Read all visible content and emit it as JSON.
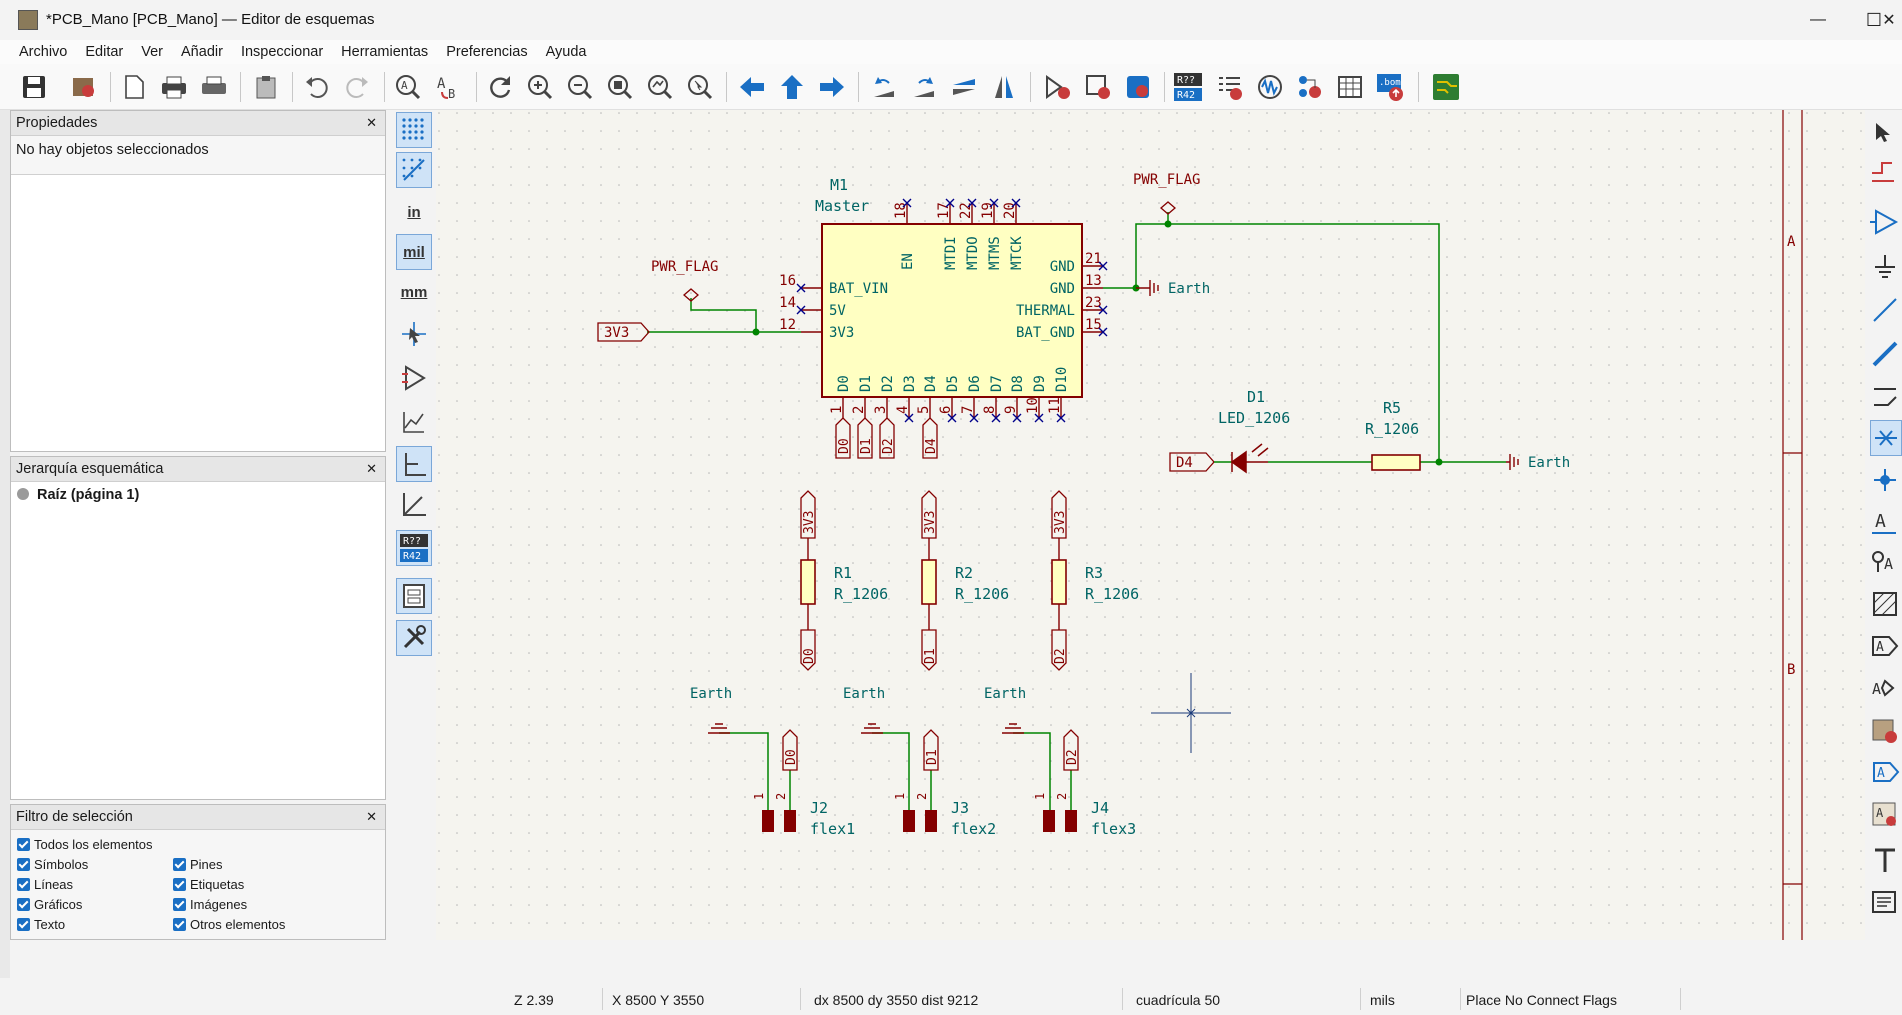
{
  "window": {
    "title": "*PCB_Mano [PCB_Mano] — Editor de esquemas",
    "controls": {
      "minimize": "—",
      "maximize": "☐",
      "close": "✕"
    }
  },
  "menu": [
    "Archivo",
    "Editar",
    "Ver",
    "Añadir",
    "Inspeccionar",
    "Herramientas",
    "Preferencias",
    "Ayuda"
  ],
  "toolbar": {
    "icons": [
      "save-icon",
      "schematic-setup-icon",
      "page-settings-icon",
      "print-icon",
      "plot-icon",
      "paste-icon",
      "undo-icon",
      "redo-icon",
      "find-icon",
      "find-replace-icon",
      "refresh-icon",
      "zoom-in-icon",
      "zoom-out-icon",
      "zoom-fit-icon",
      "zoom-objects-icon",
      "zoom-selection-icon",
      "navigate-back-icon",
      "navigate-up-icon",
      "navigate-forward-icon",
      "rotate-ccw-icon",
      "rotate-cw-icon",
      "mirror-vertical-icon",
      "mirror-horizontal-icon",
      "symbol-editor-icon",
      "symbol-browser-icon",
      "footprint-assign-icon",
      "annotate-icon",
      "erc-icon",
      "simulator-icon",
      "field-editor-icon",
      "bom-icon",
      "generate-netlist-icon",
      "pcb-editor-icon"
    ],
    "annotate_top": "R??",
    "annotate_bottom": "R42",
    "bom_label": ".bom"
  },
  "properties_panel": {
    "title": "Propiedades",
    "close": "✕",
    "empty_text": "No hay objetos seleccionados"
  },
  "hierarchy_panel": {
    "title": "Jerarquía esquemática",
    "close": "✕",
    "root": "Raíz (página 1)"
  },
  "selection_filter": {
    "title": "Filtro de selección",
    "close": "✕",
    "all": "Todos los elementos",
    "col1": [
      "Símbolos",
      "Líneas",
      "Gráficos",
      "Texto"
    ],
    "col2": [
      "Pines",
      "Etiquetas",
      "Imágenes",
      "Otros elementos"
    ]
  },
  "left_tools": {
    "units_in": "in",
    "units_mil": "mil",
    "units_mm": "mm",
    "annotate_top": "R??",
    "annotate_bottom": "R42"
  },
  "schematic": {
    "border_rows": [
      "A",
      "B"
    ],
    "master": {
      "ref": "M1",
      "value": "Master",
      "left_pins": [
        {
          "num": "16",
          "name": "BAT_VIN"
        },
        {
          "num": "14",
          "name": "5V"
        },
        {
          "num": "12",
          "name": "3V3"
        }
      ],
      "right_pins": [
        {
          "num": "21",
          "name": "GND"
        },
        {
          "num": "13",
          "name": "GND"
        },
        {
          "num": "23",
          "name": "THERMAL"
        },
        {
          "num": "15",
          "name": "BAT_GND"
        }
      ],
      "top_pins": [
        {
          "num": "18",
          "name": "EN"
        },
        {
          "num": "17",
          "name": "MTDI"
        },
        {
          "num": "22",
          "name": "MTDO"
        },
        {
          "num": "19",
          "name": "MTMS"
        },
        {
          "num": "20",
          "name": "MTCK"
        }
      ],
      "bottom_pins": [
        {
          "num": "1",
          "name": "D0"
        },
        {
          "num": "2",
          "name": "D1"
        },
        {
          "num": "3",
          "name": "D2"
        },
        {
          "num": "4",
          "name": "D3"
        },
        {
          "num": "5",
          "name": "D4"
        },
        {
          "num": "6",
          "name": "D5"
        },
        {
          "num": "7",
          "name": "D6"
        },
        {
          "num": "8",
          "name": "D7"
        },
        {
          "num": "9",
          "name": "D8"
        },
        {
          "num": "10",
          "name": "D9"
        },
        {
          "num": "11",
          "name": "D10"
        }
      ]
    },
    "pwr_flag": "PWR_FLAG",
    "earth": "Earth",
    "label_3v3": "3V3",
    "labels_d": [
      "D0",
      "D1",
      "D2",
      "D4"
    ],
    "d1": {
      "ref": "D1",
      "value": "LED_1206"
    },
    "r5": {
      "ref": "R5",
      "value": "R_1206"
    },
    "resistors": [
      {
        "ref": "R1",
        "value": "R_1206",
        "net_top": "3V3",
        "net_bottom": "D0"
      },
      {
        "ref": "R2",
        "value": "R_1206",
        "net_top": "3V3",
        "net_bottom": "D1"
      },
      {
        "ref": "R3",
        "value": "R_1206",
        "net_top": "3V3",
        "net_bottom": "D2"
      }
    ],
    "connectors": [
      {
        "ref": "J2",
        "value": "flex1",
        "net": "D0",
        "pin1": "1",
        "pin2": "2"
      },
      {
        "ref": "J3",
        "value": "flex2",
        "net": "D1",
        "pin1": "1",
        "pin2": "2"
      },
      {
        "ref": "J4",
        "value": "flex3",
        "net": "D2",
        "pin1": "1",
        "pin2": "2"
      }
    ]
  },
  "statusbar": {
    "zoom": "Z 2.39",
    "coords": "X 8500  Y 3550",
    "delta": "dx 8500  dy 3550  dist 9212",
    "grid": "cuadrícula 50",
    "units": "mils",
    "tool": "Place No Connect Flags"
  },
  "colors": {
    "symbol_body": "#ffffc2",
    "symbol_outline": "#840000",
    "wire": "#008400",
    "pin_text": "#006464",
    "canvas": "#f5f4ef",
    "accent": "#1a6fc4"
  }
}
